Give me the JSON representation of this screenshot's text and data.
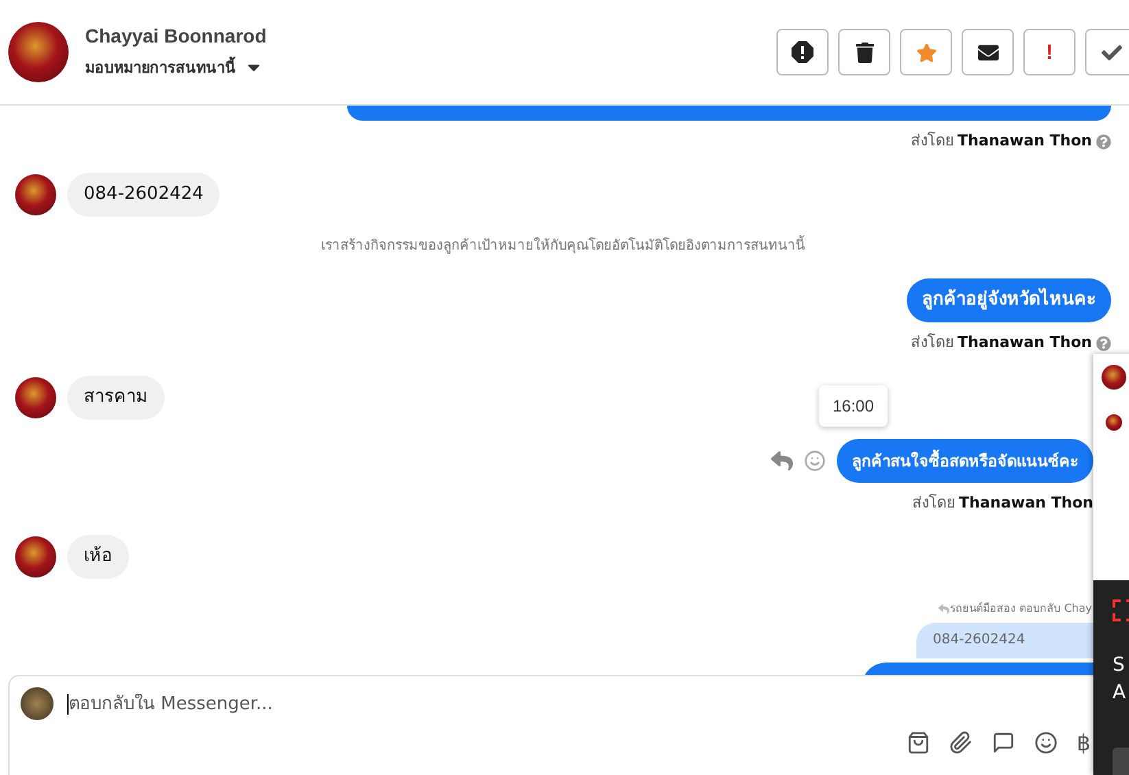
{
  "header": {
    "name": "Chayyai Boonnarod",
    "assign": "มอบหมายการสนทนานี้",
    "actions": [
      {
        "kind": "spam"
      },
      {
        "kind": "delete"
      },
      {
        "kind": "star"
      },
      {
        "kind": "unread"
      },
      {
        "kind": "important",
        "text": "!"
      },
      {
        "kind": "done"
      }
    ]
  },
  "messages": [
    {
      "kind": "cut-top"
    },
    {
      "kind": "sender",
      "prefix": "ส่งโดย",
      "name": "Thanawan Thon",
      "help": true
    },
    {
      "kind": "in",
      "text": "084-2602424"
    },
    {
      "kind": "system",
      "text": "เราสร้างกิจกรรมของลูกค้าเป้าหมายให้กับคุณโดยอัตโนมัติโดยอิงตามการสนทนานี้"
    },
    {
      "kind": "out",
      "text": "ลูกค้าอยู่จังหวัดไหนคะ",
      "hover": false
    },
    {
      "kind": "sender",
      "prefix": "ส่งโดย",
      "name": "Thanawan Thon",
      "help": true
    },
    {
      "kind": "in",
      "text": "สารคาม"
    },
    {
      "kind": "out",
      "text": "ลูกค้าสนใจซื้อสดหรือจัดแนนซ์คะ",
      "tooltip": "16:00",
      "hover": true
    },
    {
      "kind": "sender",
      "prefix": "ส่งโดย",
      "name": "Thanawan Thon",
      "help": false
    },
    {
      "kind": "in",
      "text": "เห้อ"
    },
    {
      "kind": "replyto",
      "text": "รถยนต์มือสอง ตอบกลับ Chay"
    },
    {
      "kind": "quote",
      "text": "084-2602424"
    },
    {
      "kind": "cut-bottom"
    }
  ],
  "composer": {
    "placeholder": "ตอบกลับใน Messenger...",
    "tools": [
      {
        "kind": "bag"
      },
      {
        "kind": "clip"
      },
      {
        "kind": "chat"
      },
      {
        "kind": "smile"
      },
      {
        "kind": "baht",
        "text": "฿"
      }
    ]
  },
  "overlay": {
    "lines": [
      "S",
      "A"
    ]
  }
}
